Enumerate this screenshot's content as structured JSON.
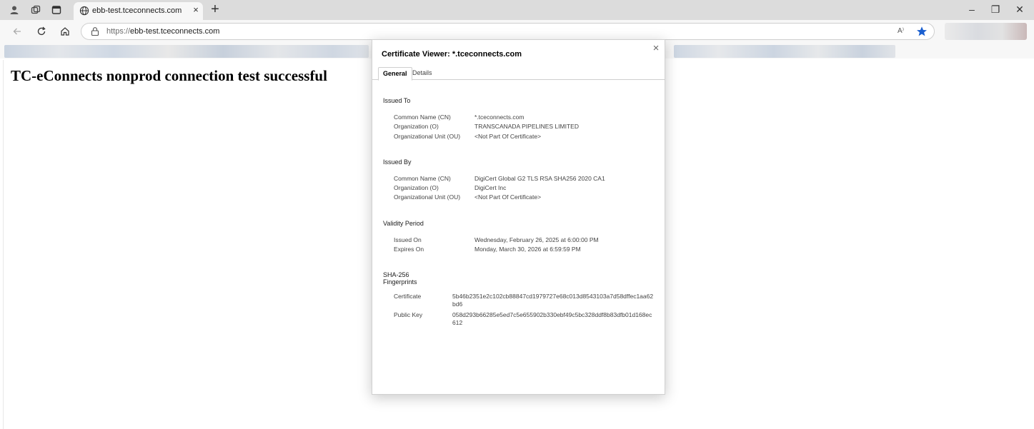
{
  "browser": {
    "tab": {
      "title": "ebb-test.tceconnects.com",
      "close": "×"
    },
    "new_tab": "+",
    "window_controls": {
      "minimize": "–",
      "restore": "❐",
      "close": "✕"
    },
    "address": {
      "prefix": "https://",
      "host": "ebb-test.tceconnects.com"
    },
    "read_aloud": "A⁾",
    "icons": [
      "profile-icon",
      "workspaces-icon",
      "tab-actions-icon",
      "back-icon",
      "refresh-icon",
      "home-icon",
      "site-info-icon",
      "favorite-star-icon"
    ]
  },
  "page": {
    "heading": "TC-eConnects nonprod connection test successful"
  },
  "certificate_viewer": {
    "title": "Certificate Viewer: *.tceconnects.com",
    "close": "×",
    "tabs": [
      {
        "label": "General",
        "active": true
      },
      {
        "label": "Details",
        "active": false
      }
    ],
    "issued_to": {
      "title": "Issued To",
      "rows": [
        {
          "label": "Common Name (CN)",
          "value": "*.tceconnects.com"
        },
        {
          "label": "Organization (O)",
          "value": "TRANSCANADA PIPELINES LIMITED"
        },
        {
          "label": "Organizational Unit (OU)",
          "value": "<Not Part Of Certificate>"
        }
      ]
    },
    "issued_by": {
      "title": "Issued By",
      "rows": [
        {
          "label": "Common Name (CN)",
          "value": "DigiCert Global G2 TLS RSA SHA256 2020 CA1"
        },
        {
          "label": "Organization (O)",
          "value": "DigiCert Inc"
        },
        {
          "label": "Organizational Unit (OU)",
          "value": "<Not Part Of Certificate>"
        }
      ]
    },
    "validity": {
      "title": "Validity Period",
      "rows": [
        {
          "label": "Issued On",
          "value": "Wednesday, February 26, 2025 at 6:00:00 PM"
        },
        {
          "label": "Expires On",
          "value": "Monday, March 30, 2026 at 6:59:59 PM"
        }
      ]
    },
    "fingerprints": {
      "title_line1": "SHA-256",
      "title_line2": "Fingerprints",
      "rows": [
        {
          "label": "Certificate",
          "value": "5b46b2351e2c102cb88847cd1979727e68c013d8543103a7d58dffec1aa62bd6"
        },
        {
          "label": "Public Key",
          "value": "058d293b66285e5ed7c5e655902b330ebf49c5bc328ddf8b83dfb01d168ec612"
        }
      ]
    }
  },
  "colors": {
    "tabstrip_bg": "#dcdcdc",
    "toolbar_bg": "#f7f7f7",
    "star_accent": "#1a5fcf"
  }
}
